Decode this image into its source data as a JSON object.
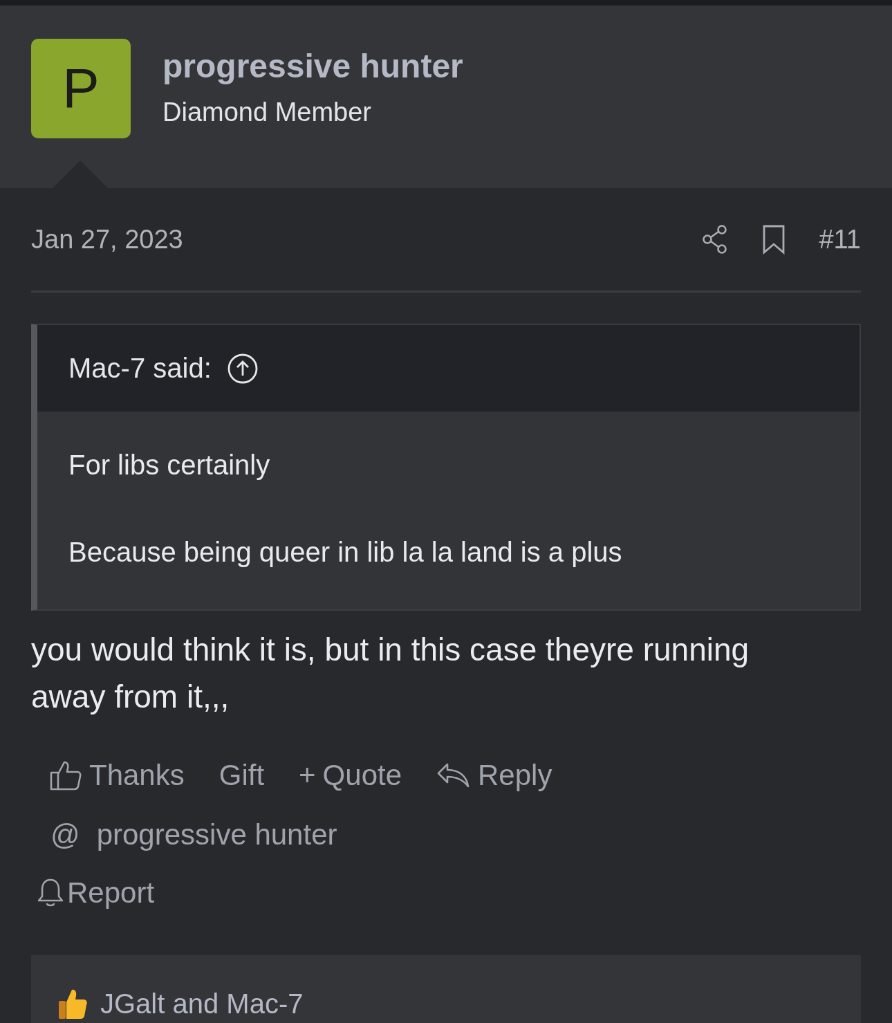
{
  "author": {
    "initial": "P",
    "name": "progressive hunter",
    "title": "Diamond Member"
  },
  "post": {
    "date": "Jan 27, 2023",
    "number": "#11",
    "quote": {
      "header": "Mac-7 said:",
      "paragraphs": [
        "For libs certainly",
        "Because being queer in lib la la land is a plus"
      ]
    },
    "body": "you would think it is, but in this case theyre running away from it,,,",
    "actions": [
      {
        "kind": "thanks",
        "label": "Thanks"
      },
      {
        "kind": "plain",
        "label": "Gift"
      },
      {
        "kind": "plus",
        "label": "+",
        "text": "Quote"
      },
      {
        "kind": "reply",
        "label": "Reply"
      }
    ],
    "mention": {
      "symbol": "@",
      "label": "progressive hunter"
    },
    "report": "Report",
    "reactions": "JGalt and Mac-7"
  }
}
